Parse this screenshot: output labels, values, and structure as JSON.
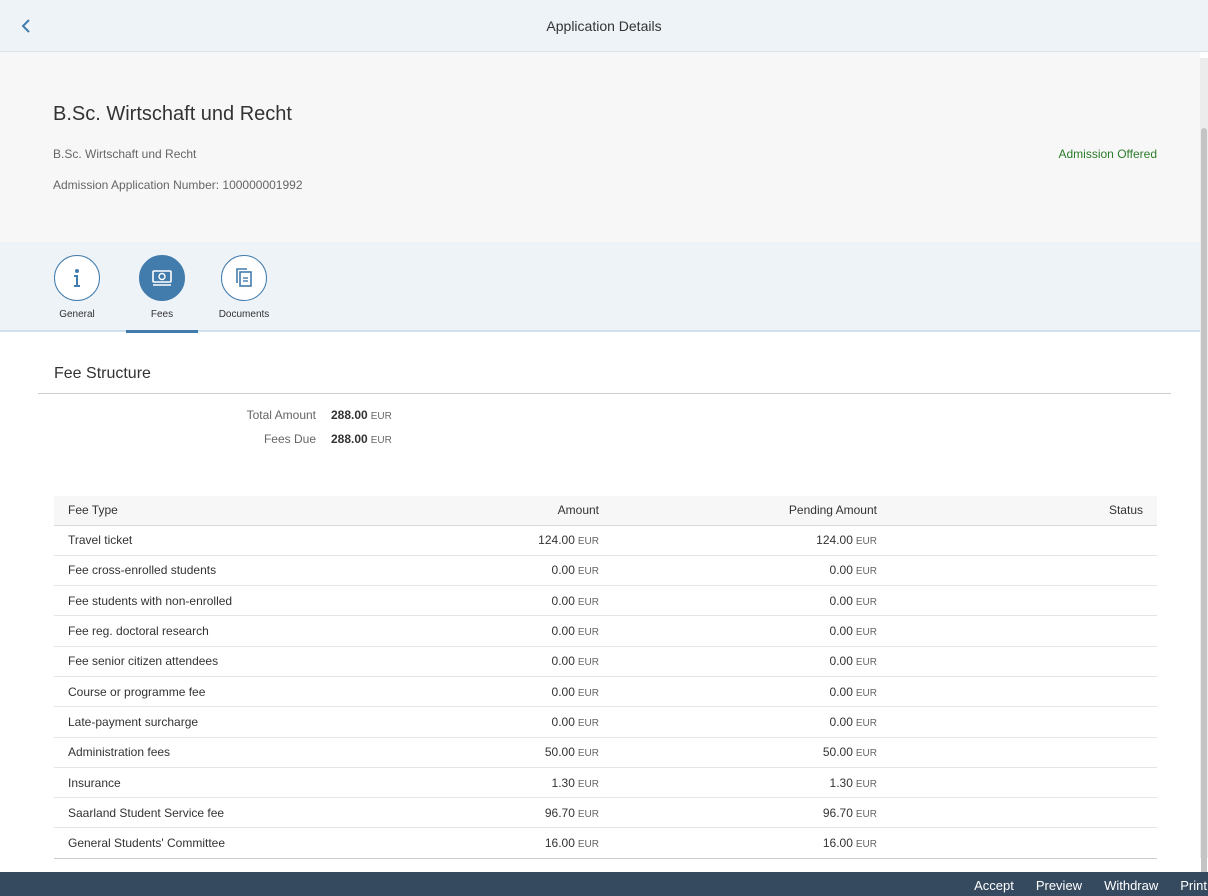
{
  "topbar": {
    "title": "Application Details"
  },
  "header": {
    "title": "B.Sc. Wirtschaft und Recht",
    "subtitle": "B.Sc. Wirtschaft und Recht",
    "application_number": "Admission Application Number: 100000001992",
    "status": "Admission Offered",
    "status_color": "#2b7c2b"
  },
  "tabs": [
    {
      "label": "General",
      "icon": "info-icon",
      "selected": false
    },
    {
      "label": "Fees",
      "icon": "money-icon",
      "selected": true
    },
    {
      "label": "Documents",
      "icon": "documents-icon",
      "selected": false
    }
  ],
  "fees": {
    "section_title": "Fee Structure",
    "summary": [
      {
        "label": "Total Amount",
        "value": "288.00",
        "currency": "EUR"
      },
      {
        "label": "Fees Due",
        "value": "288.00",
        "currency": "EUR"
      }
    ],
    "columns": [
      "Fee Type",
      "Amount",
      "Pending Amount",
      "Status"
    ],
    "rows": [
      {
        "type": "Travel ticket",
        "amount": "124.00",
        "pending": "124.00",
        "currency": "EUR",
        "status": ""
      },
      {
        "type": "Fee cross-enrolled students",
        "amount": "0.00",
        "pending": "0.00",
        "currency": "EUR",
        "status": ""
      },
      {
        "type": "Fee students with non-enrolled",
        "amount": "0.00",
        "pending": "0.00",
        "currency": "EUR",
        "status": ""
      },
      {
        "type": "Fee reg. doctoral research",
        "amount": "0.00",
        "pending": "0.00",
        "currency": "EUR",
        "status": ""
      },
      {
        "type": "Fee senior citizen attendees",
        "amount": "0.00",
        "pending": "0.00",
        "currency": "EUR",
        "status": ""
      },
      {
        "type": "Course or programme fee",
        "amount": "0.00",
        "pending": "0.00",
        "currency": "EUR",
        "status": ""
      },
      {
        "type": "Late-payment surcharge",
        "amount": "0.00",
        "pending": "0.00",
        "currency": "EUR",
        "status": ""
      },
      {
        "type": "Administration fees",
        "amount": "50.00",
        "pending": "50.00",
        "currency": "EUR",
        "status": ""
      },
      {
        "type": "Insurance",
        "amount": "1.30",
        "pending": "1.30",
        "currency": "EUR",
        "status": ""
      },
      {
        "type": "Saarland Student Service fee",
        "amount": "96.70",
        "pending": "96.70",
        "currency": "EUR",
        "status": ""
      },
      {
        "type": "General Students' Committee",
        "amount": "16.00",
        "pending": "16.00",
        "currency": "EUR",
        "status": ""
      }
    ]
  },
  "footer": {
    "actions": [
      "Accept",
      "Preview",
      "Withdraw",
      "Print"
    ]
  },
  "colors": {
    "accent": "#427cac",
    "footer_bg": "#354a5f",
    "topbar_bg": "#eef3f8"
  }
}
